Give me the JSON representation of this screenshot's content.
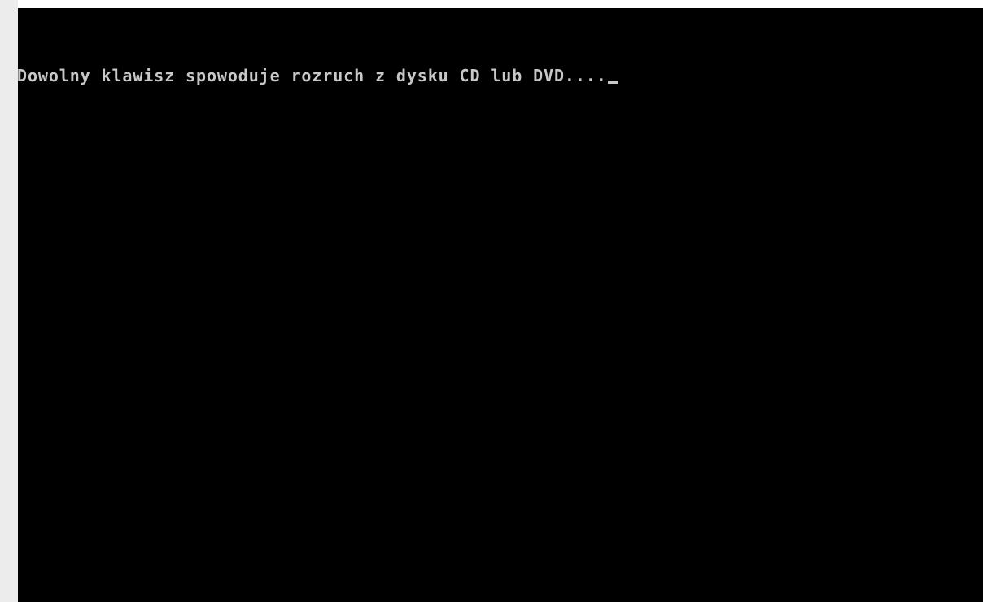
{
  "console": {
    "prompt_text": "Dowolny klawisz spowoduje rozruch z dysku CD lub DVD....",
    "cursor_glyph": "cursor-block-icon",
    "colors": {
      "background": "#000000",
      "text": "#c8c8c8",
      "margin": "#ececec"
    }
  }
}
